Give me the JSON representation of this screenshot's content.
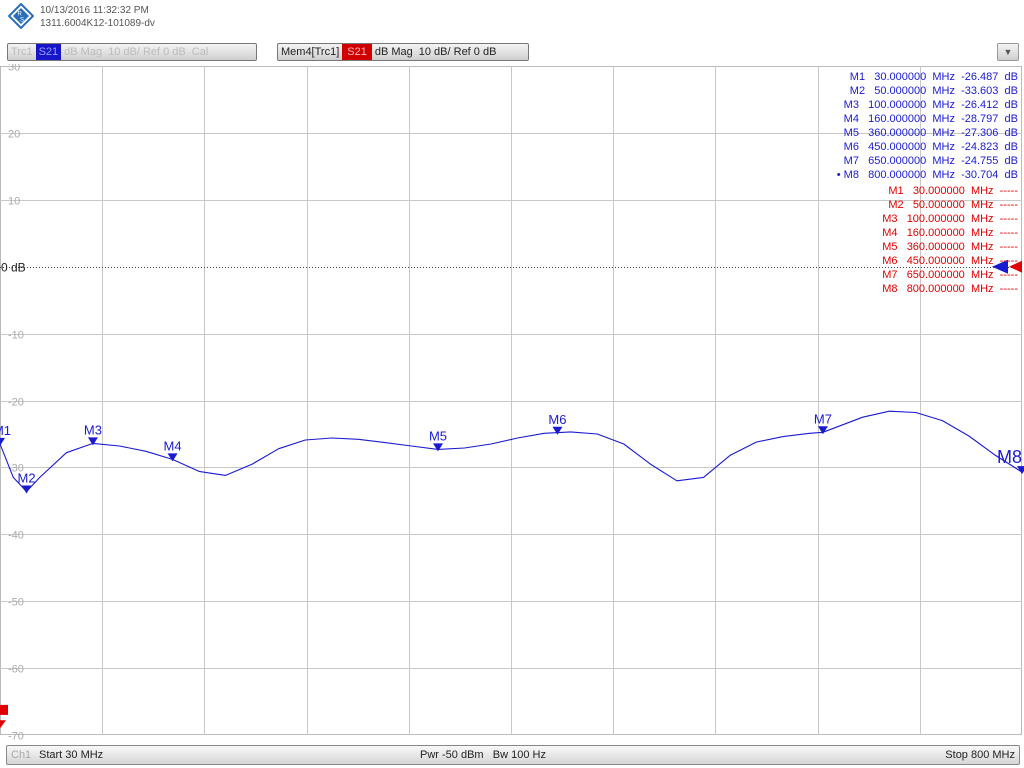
{
  "header": {
    "datetime": "10/13/2016 11:32:32 PM",
    "instrument_id": "1311.6004K12-101089-dv"
  },
  "trace_tabs": [
    {
      "name": "Trc1",
      "channel": "S21",
      "format": "dB Mag",
      "scale": "10 dB/ Ref 0 dB",
      "suffix": "Cal"
    },
    {
      "name": "Mem4[Trc1]",
      "channel": "S21",
      "format": "dB Mag",
      "scale": "10 dB/ Ref 0 dB"
    }
  ],
  "footer": {
    "channel": "Ch1",
    "start": "Start  30 MHz",
    "pwr": "Pwr  -50 dBm",
    "bw": "Bw  100 Hz",
    "stop": "Stop  800 MHz"
  },
  "colors": {
    "trace": "#1a1ad0",
    "memory": "#e00000",
    "grid": "#c8c8c8"
  },
  "chart_data": {
    "type": "line",
    "xlim": [
      30,
      800
    ],
    "ylim": [
      -70,
      30
    ],
    "y_ticks": [
      30,
      20,
      10,
      0,
      -10,
      -20,
      -30,
      -40,
      -50,
      -60,
      -70
    ],
    "y_tick_labels": [
      "30",
      "20",
      "10",
      "0 dB",
      "-10",
      "-20",
      "-30",
      "-40",
      "-50",
      "-60",
      "-70"
    ],
    "ref_level": 0,
    "grid": true,
    "series": [
      {
        "x": [
          30,
          40,
          50,
          60,
          80,
          100,
          120,
          140,
          160,
          180,
          200,
          220,
          240,
          260,
          280,
          300,
          320,
          340,
          360,
          380,
          400,
          420,
          440,
          460,
          480,
          500,
          520,
          540,
          560,
          580,
          600,
          620,
          640,
          650,
          680,
          700,
          720,
          740,
          760,
          780,
          800
        ],
        "y": [
          -26.487,
          -31.5,
          -33.603,
          -31.5,
          -27.8,
          -26.412,
          -26.8,
          -27.6,
          -28.797,
          -30.6,
          -31.2,
          -29.5,
          -27.2,
          -25.9,
          -25.6,
          -25.8,
          -26.3,
          -26.8,
          -27.306,
          -27.1,
          -26.5,
          -25.6,
          -24.9,
          -24.7,
          -25.0,
          -26.5,
          -29.5,
          -32.0,
          -31.5,
          -28.2,
          -26.2,
          -25.4,
          -24.9,
          -24.755,
          -22.5,
          -21.6,
          -21.8,
          -23.0,
          -25.3,
          -28.2,
          -30.704
        ]
      }
    ],
    "markers": [
      {
        "label": "M1",
        "freq": "30.000000",
        "unit": "MHz",
        "value": "-26.487",
        "value_unit": "dB",
        "x": 30,
        "y": -26.487
      },
      {
        "label": "M2",
        "freq": "50.000000",
        "unit": "MHz",
        "value": "-33.603",
        "value_unit": "dB",
        "x": 50,
        "y": -33.603
      },
      {
        "label": "M3",
        "freq": "100.000000",
        "unit": "MHz",
        "value": "-26.412",
        "value_unit": "dB",
        "x": 100,
        "y": -26.412
      },
      {
        "label": "M4",
        "freq": "160.000000",
        "unit": "MHz",
        "value": "-28.797",
        "value_unit": "dB",
        "x": 160,
        "y": -28.797
      },
      {
        "label": "M5",
        "freq": "360.000000",
        "unit": "MHz",
        "value": "-27.306",
        "value_unit": "dB",
        "x": 360,
        "y": -27.306
      },
      {
        "label": "M6",
        "freq": "450.000000",
        "unit": "MHz",
        "value": "-24.823",
        "value_unit": "dB",
        "x": 450,
        "y": -24.823
      },
      {
        "label": "M7",
        "freq": "650.000000",
        "unit": "MHz",
        "value": "-24.755",
        "value_unit": "dB",
        "x": 650,
        "y": -24.755
      },
      {
        "label": "M8",
        "freq": "800.000000",
        "unit": "MHz",
        "value": "-30.704",
        "value_unit": "dB",
        "x": 800,
        "y": -30.704
      }
    ],
    "memory_markers": [
      {
        "label": "M1",
        "freq": "30.000000",
        "unit": "MHz",
        "value": "-----"
      },
      {
        "label": "M2",
        "freq": "50.000000",
        "unit": "MHz",
        "value": "-----"
      },
      {
        "label": "M3",
        "freq": "100.000000",
        "unit": "MHz",
        "value": "-----"
      },
      {
        "label": "M4",
        "freq": "160.000000",
        "unit": "MHz",
        "value": "-----"
      },
      {
        "label": "M5",
        "freq": "360.000000",
        "unit": "MHz",
        "value": "-----"
      },
      {
        "label": "M6",
        "freq": "450.000000",
        "unit": "MHz",
        "value": "-----"
      },
      {
        "label": "M7",
        "freq": "650.000000",
        "unit": "MHz",
        "value": "-----"
      },
      {
        "label": "M8",
        "freq": "800.000000",
        "unit": "MHz",
        "value": "-----"
      }
    ]
  }
}
